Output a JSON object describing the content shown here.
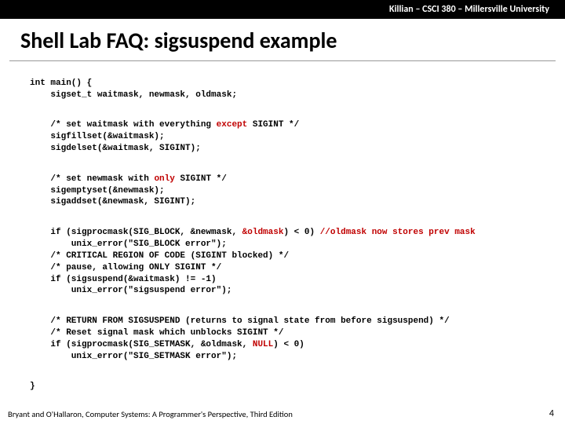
{
  "header": {
    "course": "Killian – CSCI 380 – Millersville University"
  },
  "title": "Shell Lab FAQ: sigsuspend example",
  "code": {
    "l1": "int main() {",
    "l2": "    sigset_t waitmask, newmask, oldmask;",
    "l3a": "    /* set waitmask with everything ",
    "l3b": "except",
    "l3c": " SIGINT */",
    "l4": "    sigfillset(&waitmask);",
    "l5": "    sigdelset(&waitmask, SIGINT);",
    "l6a": "    /* set newmask with ",
    "l6b": "only",
    "l6c": " SIGINT */",
    "l7": "    sigemptyset(&newmask);",
    "l8": "    sigaddset(&newmask, SIGINT);",
    "l9a": "    if (sigprocmask(SIG_BLOCK, &newmask, ",
    "l9b": "&oldmask",
    "l9c": ") < 0) ",
    "l9d": "//oldmask now stores prev mask",
    "l10": "        unix_error(\"SIG_BLOCK error\");",
    "l11": "    /* CRITICAL REGION OF CODE (SIGINT blocked) */",
    "l12": "    /* pause, allowing ONLY SIGINT */",
    "l13": "    if (sigsuspend(&waitmask) != -1)",
    "l14": "        unix_error(\"sigsuspend error\");",
    "l15": "    /* RETURN FROM SIGSUSPEND (returns to signal state from before sigsuspend) */",
    "l16": "    /* Reset signal mask which unblocks SIGINT */",
    "l17a": "    if (sigprocmask(SIG_SETMASK, &oldmask, ",
    "l17b": "NULL",
    "l17c": ") < 0)",
    "l18": "        unix_error(\"SIG_SETMASK error\");",
    "l19": "}"
  },
  "footer": {
    "text": "Bryant and O'Hallaron, Computer Systems: A Programmer's Perspective, Third Edition",
    "page": "4"
  }
}
